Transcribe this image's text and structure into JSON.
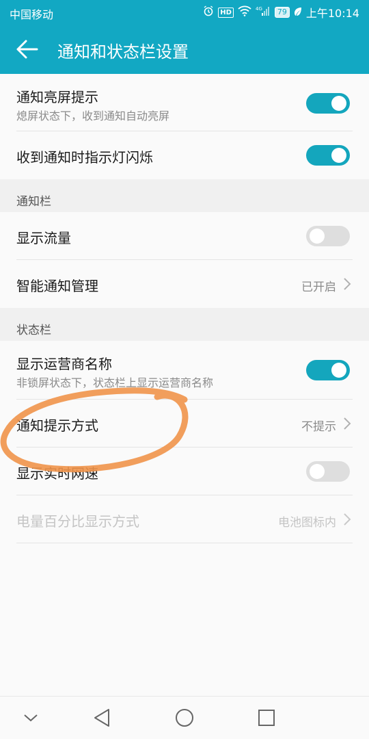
{
  "status_bar": {
    "carrier": "中国移动",
    "signal_label": "4G",
    "battery_level": "79",
    "time": "上午10:14",
    "hd_label": "HD",
    "icons": [
      "alarm-icon",
      "hd-icon",
      "wifi-icon",
      "signal-icon",
      "battery-icon",
      "leaf-icon"
    ]
  },
  "app_bar": {
    "title": "通知和状态栏设置"
  },
  "rows": {
    "wake_screen": {
      "title": "通知亮屏提示",
      "subtitle": "熄屏状态下，收到通知自动亮屏",
      "on": true
    },
    "led_blink": {
      "title": "收到通知时指示灯闪烁",
      "on": true
    },
    "section_notification": "通知栏",
    "show_traffic": {
      "title": "显示流量",
      "on": false
    },
    "smart_notification": {
      "title": "智能通知管理",
      "value": "已开启"
    },
    "section_status": "状态栏",
    "carrier_name": {
      "title": "显示运营商名称",
      "subtitle": "非锁屏状态下，状态栏上显示运营商名称",
      "on": true
    },
    "notify_style": {
      "title": "通知提示方式",
      "value": "不提示"
    },
    "realtime_speed": {
      "title": "显示实时网速",
      "on": false
    },
    "battery_percent": {
      "title": "电量百分比显示方式",
      "value": "电池图标内",
      "disabled": true
    }
  },
  "nav_bar": {
    "icons": [
      "collapse-icon",
      "back-triangle-icon",
      "home-circle-icon",
      "recents-square-icon"
    ]
  },
  "colors": {
    "accent": "#12a8c3",
    "toggle_on": "#14a6bd",
    "annotation": "#f0934a"
  }
}
